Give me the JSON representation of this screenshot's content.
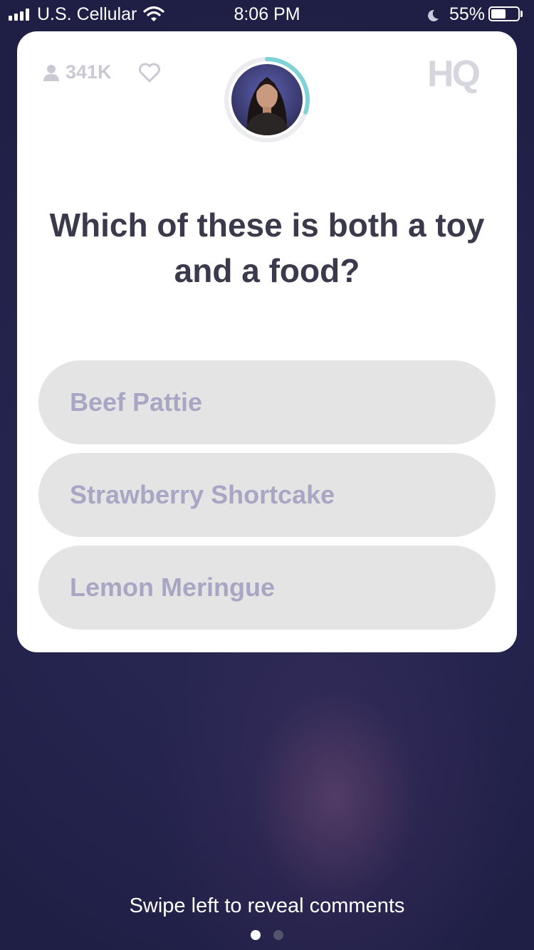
{
  "status_bar": {
    "carrier": "U.S. Cellular",
    "time": "8:06 PM",
    "battery_percent": "55%",
    "battery_level": 0.55,
    "signal_icon": "signal-bars-icon",
    "wifi_icon": "wifi-icon",
    "moon_icon": "do-not-disturb-moon-icon"
  },
  "header": {
    "viewer_count": "341K",
    "viewers_icon": "person-icon",
    "like_icon": "heart-icon",
    "host_avatar": "host-avatar",
    "countdown_progress": 0.3,
    "logo_text": "HQ"
  },
  "question": {
    "text": "Which of these is both a toy and a food?"
  },
  "answers": [
    {
      "label": "Beef Pattie"
    },
    {
      "label": "Strawberry Shortcake"
    },
    {
      "label": "Lemon Meringue"
    }
  ],
  "footer": {
    "hint": "Swipe left to reveal comments",
    "page_count": 2,
    "active_page": 1
  },
  "colors": {
    "accent_timer": "#7fd3d6",
    "answer_bg": "#e4e4e4",
    "answer_text": "#a8a6c4",
    "question_text": "#3a3a4c",
    "background": "#24234d"
  }
}
